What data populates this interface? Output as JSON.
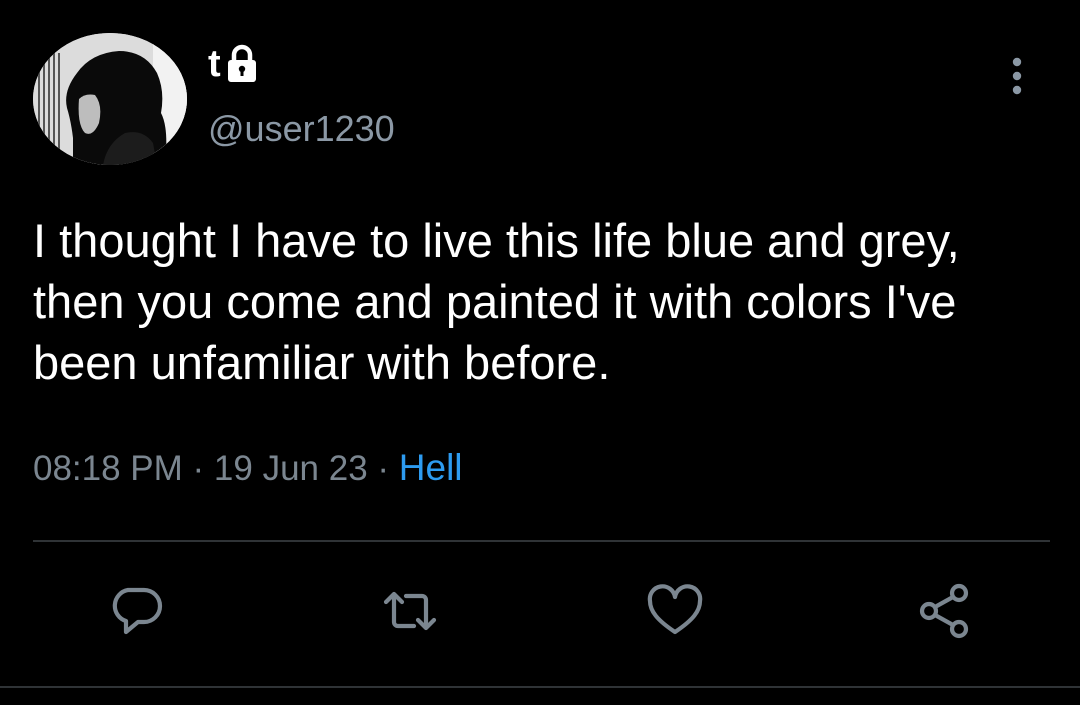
{
  "tweet": {
    "display_name": "t",
    "handle": "@user1230",
    "protected_icon": "lock-icon",
    "text": "I thought I have to live this life blue and grey, then you come and painted it with colors I've been unfamiliar with before.",
    "time": "08:18 PM",
    "separator": " · ",
    "date": "19 Jun 23",
    "source": "Hell"
  },
  "actions": [
    {
      "name": "reply",
      "icon": "reply-icon"
    },
    {
      "name": "retweet",
      "icon": "retweet-icon"
    },
    {
      "name": "like",
      "icon": "heart-icon"
    },
    {
      "name": "share",
      "icon": "share-icon"
    }
  ],
  "colors": {
    "background": "#000000",
    "text": "#ffffff",
    "secondary": "#8b98a5",
    "link": "#2d9bf0",
    "icon": "#7b8690",
    "divider": "#2f3336"
  }
}
